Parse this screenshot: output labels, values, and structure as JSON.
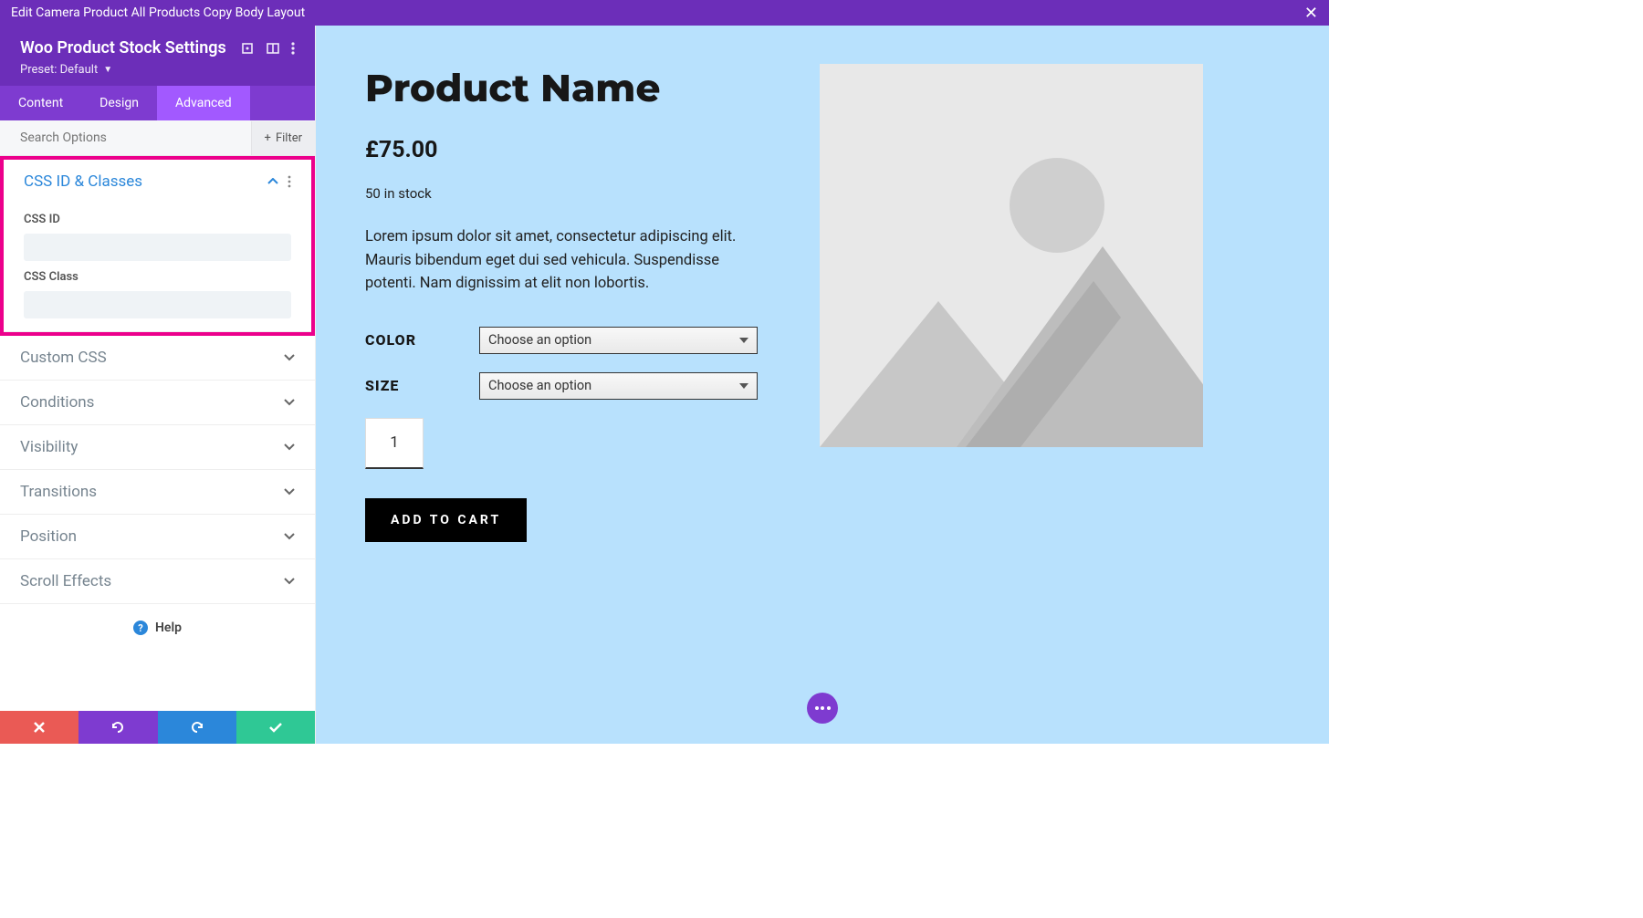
{
  "topBar": {
    "title": "Edit Camera Product All Products Copy Body Layout"
  },
  "sidebar": {
    "title": "Woo Product Stock Settings",
    "preset": "Preset: Default",
    "tabs": [
      {
        "label": "Content",
        "active": false
      },
      {
        "label": "Design",
        "active": false
      },
      {
        "label": "Advanced",
        "active": true
      }
    ],
    "search": {
      "placeholder": "Search Options"
    },
    "filterLabel": "Filter",
    "cssSection": {
      "title": "CSS ID & Classes",
      "idLabel": "CSS ID",
      "idValue": "",
      "classLabel": "CSS Class",
      "classValue": ""
    },
    "sections": [
      {
        "title": "Custom CSS"
      },
      {
        "title": "Conditions"
      },
      {
        "title": "Visibility"
      },
      {
        "title": "Transitions"
      },
      {
        "title": "Position"
      },
      {
        "title": "Scroll Effects"
      }
    ],
    "helpLabel": "Help"
  },
  "product": {
    "title": "Product Name",
    "price": "£75.00",
    "stock": "50 in stock",
    "description": "Lorem ipsum dolor sit amet, consectetur adipiscing elit. Mauris bibendum eget dui sed vehicula. Suspendisse potenti. Nam dignissim at elit non lobortis.",
    "colorLabel": "COLOR",
    "colorPlaceholder": "Choose an option",
    "sizeLabel": "SIZE",
    "sizePlaceholder": "Choose an option",
    "quantity": "1",
    "addToCartLabel": "ADD TO CART"
  }
}
